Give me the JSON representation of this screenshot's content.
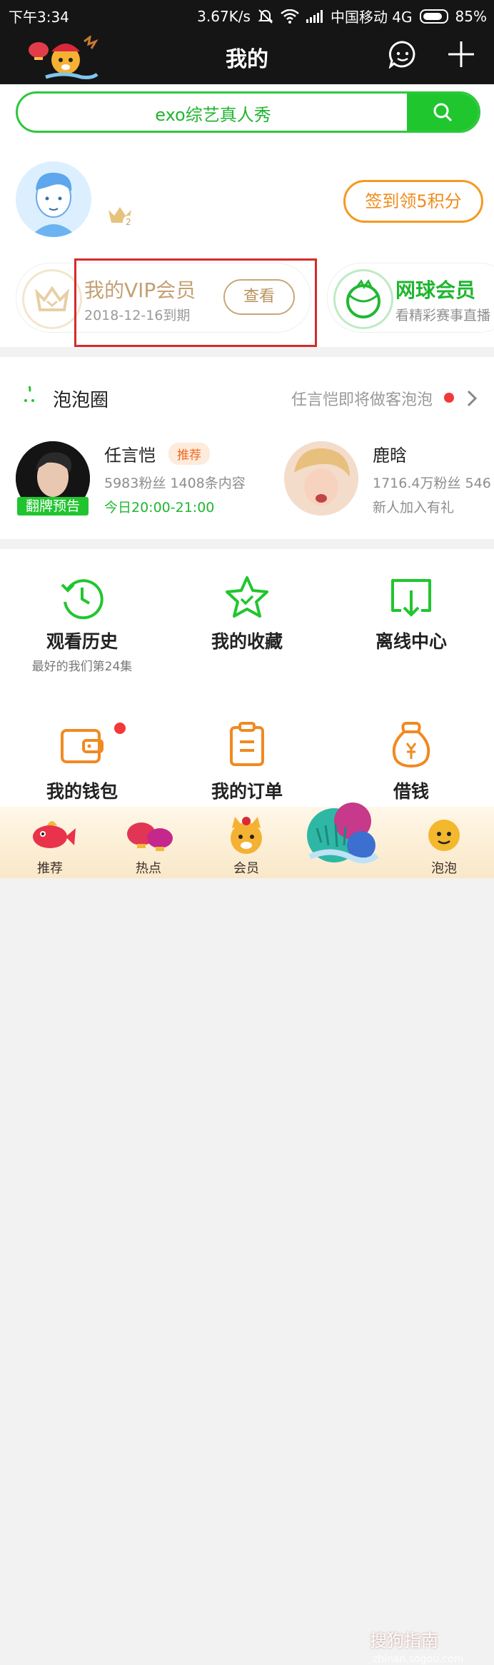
{
  "status_bar": {
    "time": "下午3:34",
    "speed": "3.67K/s",
    "carrier": "中国移动 4G",
    "battery": "85%"
  },
  "header": {
    "title": "我的"
  },
  "search": {
    "text": "exo综艺真人秀"
  },
  "profile": {
    "checkin_label": "签到领5积分"
  },
  "vip_card": {
    "title": "我的VIP会员",
    "expire": "2018-12-16到期",
    "view_label": "查看"
  },
  "tennis_card": {
    "title": "网球会员",
    "desc": "看精彩赛事直播"
  },
  "bubble": {
    "title": "泡泡圈",
    "link": "任言恺即将做客泡泡",
    "stars": [
      {
        "name": "任言恺",
        "tag": "推荐",
        "meta": "5983粉丝 1408条内容",
        "extra": "今日20:00-21:00",
        "badge": "翻牌预告"
      },
      {
        "name": "鹿晗",
        "meta": "1716.4万粉丝 546",
        "extra": "新人加入有礼"
      }
    ]
  },
  "grid": [
    {
      "label": "观看历史",
      "sub": "最好的我们第24集"
    },
    {
      "label": "我的收藏"
    },
    {
      "label": "离线中心"
    },
    {
      "label": "我的钱包"
    },
    {
      "label": "我的订单"
    },
    {
      "label": "借钱"
    }
  ],
  "tabs": [
    {
      "label": "推荐"
    },
    {
      "label": "热点"
    },
    {
      "label": "会员"
    },
    {
      "label": ""
    },
    {
      "label": "泡泡"
    }
  ],
  "watermark": {
    "text": "搜狗指南",
    "url": "zhinan.sogou.com"
  }
}
